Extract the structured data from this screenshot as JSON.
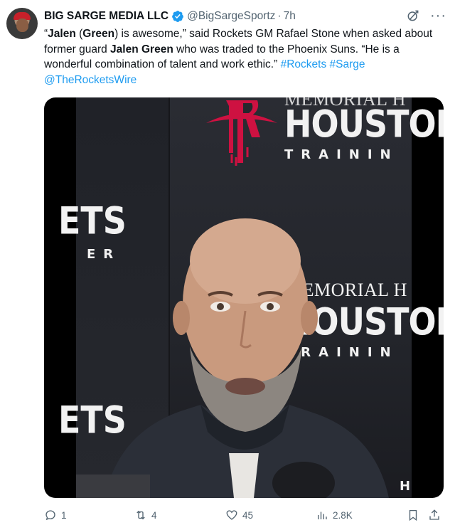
{
  "tweet": {
    "author_name": "BIG SARGE MEDIA LLC",
    "handle": "@BigSargeSportz",
    "separator": "·",
    "time": "7h",
    "more_label": "···",
    "text": {
      "p1": "“",
      "b1": "Jalen",
      "p2": " (",
      "b2": "Green",
      "p3": ") is awesome,” said Rockets GM Rafael Stone when asked about former guard ",
      "b3": "Jalen Green",
      "p4": " who was traded to the Phoenix Suns. “He is a wonderful combination of talent and work ethic.” ",
      "tag1": "#Rockets",
      "space": " ",
      "tag2": "#Sarge",
      "mention": "@TheRocketsWire"
    }
  },
  "media": {
    "backdrop_text": {
      "memorial_top": "MEMORIAL H",
      "houston_1": "HOUSTON",
      "training_1": "TRAININ",
      "frag_1": "ETS",
      "frag_2": "ER",
      "memorial_2": "MEMORIAL H",
      "houston_2": "HOUSTON",
      "training_2": "TRAININ",
      "frag_3": "ETS",
      "edge_letter": "H"
    }
  },
  "actions": {
    "replies": "1",
    "reposts": "4",
    "likes": "45",
    "views": "2.8K"
  },
  "colors": {
    "link": "#1d9bf0",
    "muted": "#536471",
    "verified": "#1d9bf0",
    "rockets_red": "#ce1141"
  },
  "icons": [
    "verified-badge-icon",
    "grok-icon",
    "more-icon",
    "reply-icon",
    "repost-icon",
    "like-icon",
    "views-icon",
    "bookmark-icon",
    "share-icon"
  ]
}
